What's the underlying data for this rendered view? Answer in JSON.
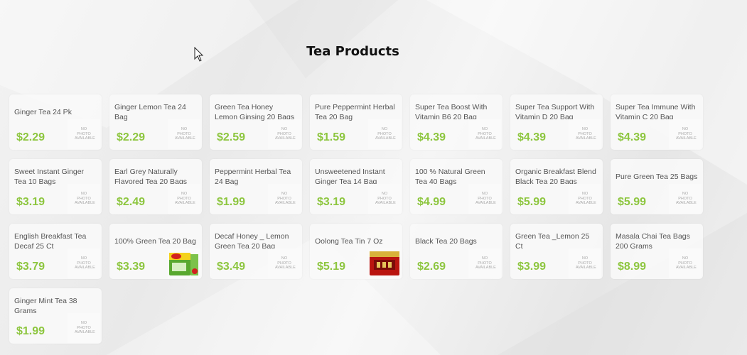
{
  "page": {
    "title": "Tea Products"
  },
  "colors": {
    "price": "#8dc63f",
    "title": "#111111",
    "card_background": "#f8f8f8"
  },
  "no_photo_text": "NO PHOTO AVAILABLE",
  "products": [
    {
      "name": "Ginger Tea 24 Pk",
      "price": "$2.29",
      "image": "no-photo"
    },
    {
      "name": "Ginger Lemon Tea 24 Bag",
      "price": "$2.29",
      "image": "no-photo"
    },
    {
      "name": "Green Tea Honey Lemon Ginsing 20 Bags",
      "price": "$2.59",
      "image": "no-photo"
    },
    {
      "name": "Pure Peppermint Herbal Tea 20 Bag",
      "price": "$1.59",
      "image": "no-photo"
    },
    {
      "name": "Super Tea Boost With Vitamin B6 20 Bag",
      "price": "$4.39",
      "image": "no-photo"
    },
    {
      "name": "Super Tea Support With Vitamin D 20 Bag",
      "price": "$4.39",
      "image": "no-photo"
    },
    {
      "name": "Super Tea Immune With Vitamin C 20 Bag",
      "price": "$4.39",
      "image": "no-photo"
    },
    {
      "name": "Sweet Instant Ginger Tea 10 Bags",
      "price": "$3.19",
      "image": "no-photo"
    },
    {
      "name": "Earl Grey Naturally Flavored Tea 20 Bags",
      "price": "$2.49",
      "image": "no-photo"
    },
    {
      "name": "Peppermint Herbal Tea 24 Bag",
      "price": "$1.99",
      "image": "no-photo"
    },
    {
      "name": "Unsweetened Instant Ginger Tea 14 Bag",
      "price": "$3.19",
      "image": "no-photo"
    },
    {
      "name": "100 % Natural Green Tea 40 Bags",
      "price": "$4.99",
      "image": "no-photo"
    },
    {
      "name": "Organic Breakfast Blend Black Tea 20 Bags",
      "price": "$5.99",
      "image": "no-photo"
    },
    {
      "name": "Pure Green Tea 25 Bags",
      "price": "$5.99",
      "image": "no-photo"
    },
    {
      "name": "English Breakfast Tea Decaf 25 Ct",
      "price": "$3.79",
      "image": "no-photo"
    },
    {
      "name": "100% Green Tea 20 Bag",
      "price": "$3.39",
      "image": "green-tea-box"
    },
    {
      "name": "Decaf Honey _ Lemon Green Tea 20 Bag",
      "price": "$3.49",
      "image": "no-photo"
    },
    {
      "name": "Oolong Tea Tin 7 Oz",
      "price": "$5.19",
      "image": "oolong-tin"
    },
    {
      "name": "Black Tea 20 Bags",
      "price": "$2.69",
      "image": "no-photo"
    },
    {
      "name": "Green Tea _Lemon 25 Ct",
      "price": "$3.99",
      "image": "no-photo"
    },
    {
      "name": "Masala Chai Tea Bags 200 Grams",
      "price": "$8.99",
      "image": "no-photo"
    },
    {
      "name": "Ginger Mint Tea 38 Grams",
      "price": "$1.99",
      "image": "no-photo"
    }
  ]
}
